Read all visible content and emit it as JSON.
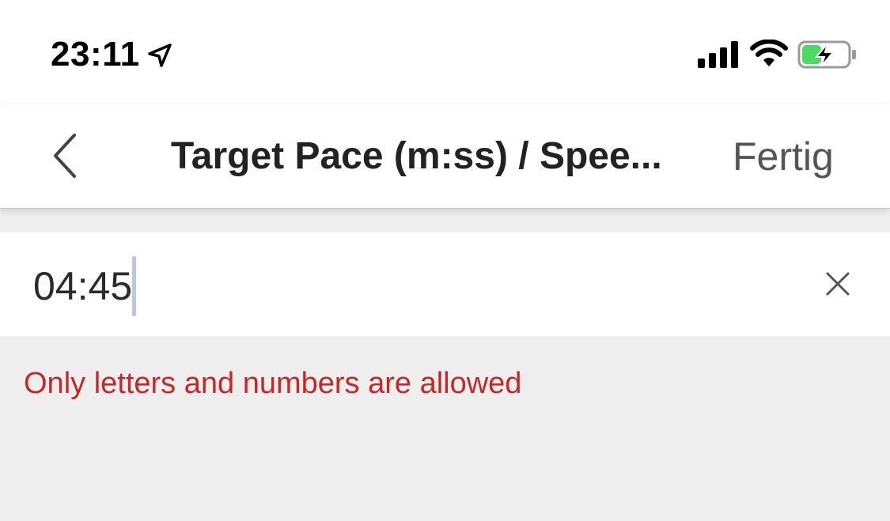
{
  "status_bar": {
    "time": "23:11",
    "location_icon": "location-arrow-icon",
    "signal_icon": "cellular-signal-icon",
    "wifi_icon": "wifi-icon",
    "battery_icon": "battery-charging-icon",
    "battery_color": "#4cd964"
  },
  "nav": {
    "back_icon": "chevron-left-icon",
    "title": "Target Pace (m:ss) / Spee...",
    "done_label": "Fertig"
  },
  "input": {
    "value": "04:45",
    "clear_icon": "close-icon",
    "caret_color": "#b7c6ee"
  },
  "validation": {
    "error": "Only letters and numbers are allowed",
    "error_color": "#c62828"
  }
}
